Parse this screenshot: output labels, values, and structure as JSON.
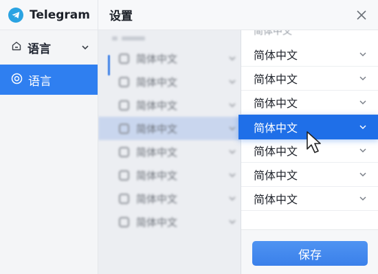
{
  "app": {
    "name": "Telegram",
    "accent": "#2f7ff0"
  },
  "sidebar": {
    "group": {
      "label": "语言",
      "icon": "home-icon",
      "expand_icon": "chevron-down-icon"
    },
    "selected_item": {
      "label": "语言",
      "icon": "radio-target-icon"
    }
  },
  "header": {
    "title": "设置",
    "close_icon": "close-icon"
  },
  "background_list": {
    "items": [
      {
        "label": "简体中文",
        "icon": "home-icon"
      },
      {
        "label": "简体中文",
        "icon": "bag-icon"
      },
      {
        "label": "简体中文",
        "icon": "badge-check-icon"
      },
      {
        "label": "简体中文",
        "icon": "bag-icon",
        "selected": true
      },
      {
        "label": "简体中文",
        "icon": "home-icon"
      },
      {
        "label": "简体中文",
        "icon": "bag-icon"
      },
      {
        "label": "简体中文",
        "icon": "home-icon"
      },
      {
        "label": "简体中文",
        "icon": "medal-icon"
      }
    ]
  },
  "dropdown": {
    "options": [
      {
        "label": "简体中文"
      },
      {
        "label": "简体中文"
      },
      {
        "label": "简体中文"
      },
      {
        "label": "简体中文",
        "active": true
      },
      {
        "label": "简体中文"
      },
      {
        "label": "简体中文"
      },
      {
        "label": "简体中文"
      }
    ],
    "save_label": "保存",
    "active_color": "#1f6fe8"
  }
}
